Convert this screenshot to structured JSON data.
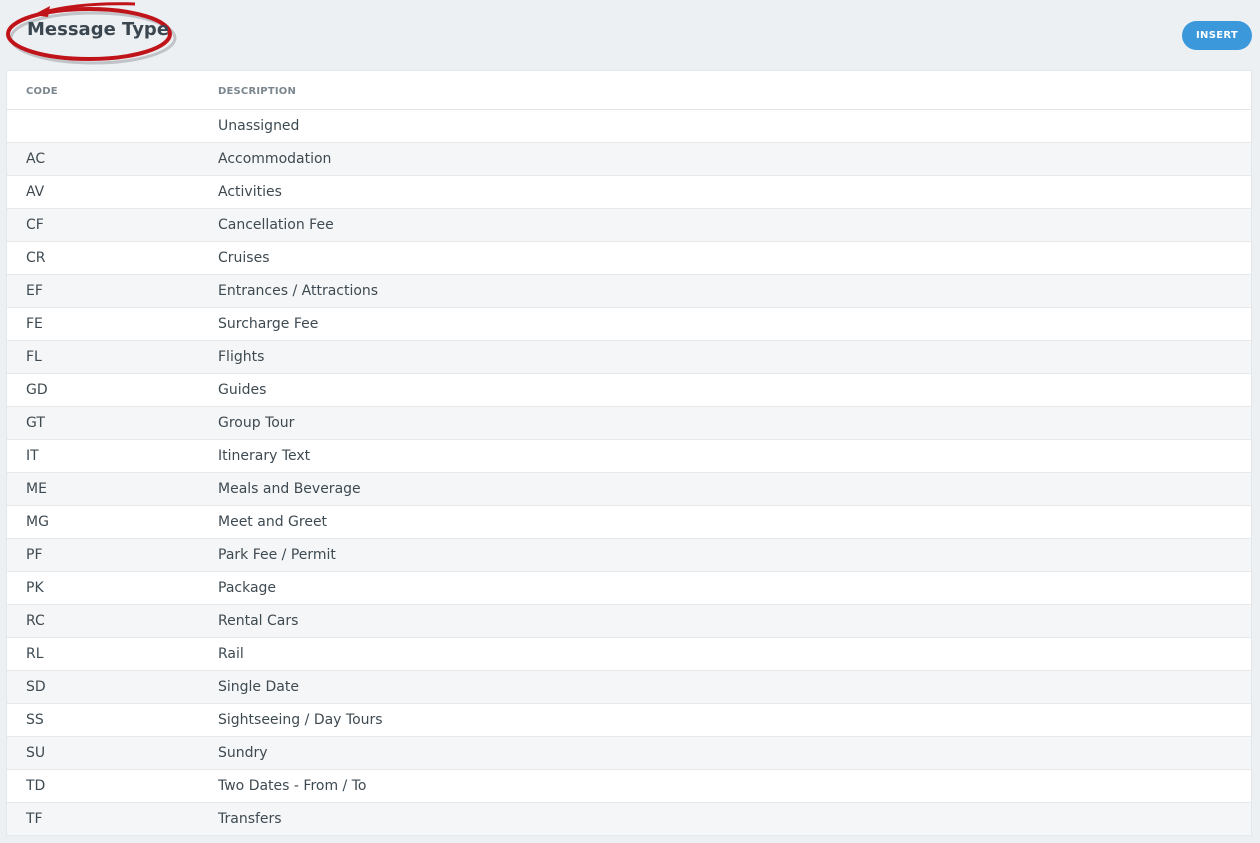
{
  "header": {
    "title": "Message Type",
    "insert_label": "INSERT"
  },
  "colors": {
    "accent": "#3b98db",
    "annotation": "#c0141b"
  },
  "table": {
    "columns": {
      "code": "CODE",
      "description": "DESCRIPTION"
    },
    "rows": [
      {
        "code": "",
        "description": "Unassigned"
      },
      {
        "code": "AC",
        "description": "Accommodation"
      },
      {
        "code": "AV",
        "description": "Activities"
      },
      {
        "code": "CF",
        "description": "Cancellation Fee"
      },
      {
        "code": "CR",
        "description": "Cruises"
      },
      {
        "code": "EF",
        "description": "Entrances / Attractions"
      },
      {
        "code": "FE",
        "description": "Surcharge Fee"
      },
      {
        "code": "FL",
        "description": "Flights"
      },
      {
        "code": "GD",
        "description": "Guides"
      },
      {
        "code": "GT",
        "description": "Group Tour"
      },
      {
        "code": "IT",
        "description": "Itinerary Text"
      },
      {
        "code": "ME",
        "description": "Meals and Beverage"
      },
      {
        "code": "MG",
        "description": "Meet and Greet"
      },
      {
        "code": "PF",
        "description": "Park Fee / Permit"
      },
      {
        "code": "PK",
        "description": "Package"
      },
      {
        "code": "RC",
        "description": "Rental Cars"
      },
      {
        "code": "RL",
        "description": "Rail"
      },
      {
        "code": "SD",
        "description": "Single Date"
      },
      {
        "code": "SS",
        "description": "Sightseeing / Day Tours"
      },
      {
        "code": "SU",
        "description": "Sundry"
      },
      {
        "code": "TD",
        "description": "Two Dates - From / To"
      },
      {
        "code": "TF",
        "description": "Transfers"
      }
    ]
  }
}
